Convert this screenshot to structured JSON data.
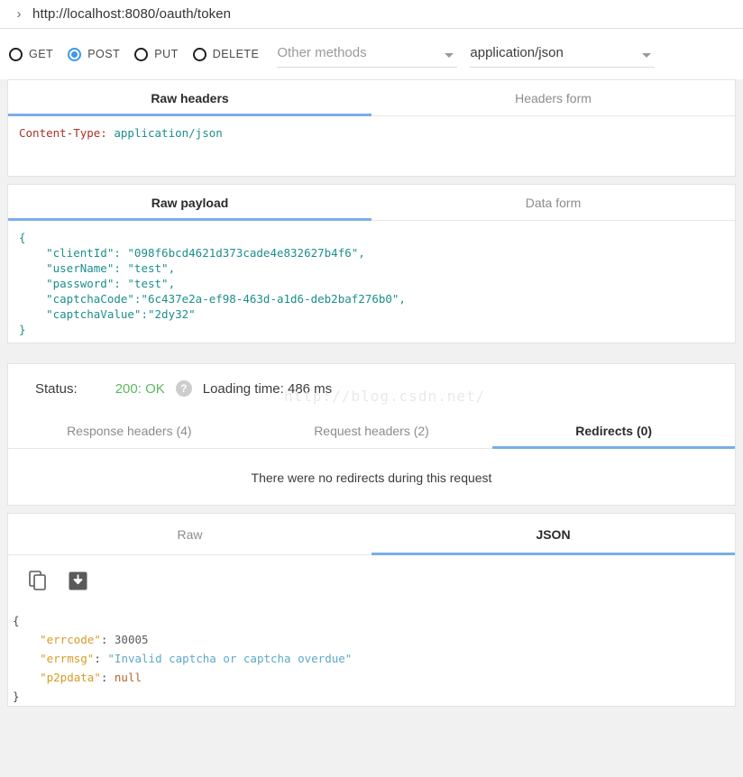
{
  "url_bar": {
    "chevron": "›",
    "url": "http://localhost:8080/oauth/token"
  },
  "method_row": {
    "methods": [
      {
        "label": "GET",
        "selected": false
      },
      {
        "label": "POST",
        "selected": true
      },
      {
        "label": "PUT",
        "selected": false
      },
      {
        "label": "DELETE",
        "selected": false
      }
    ],
    "other_methods_placeholder": "Other methods",
    "content_type_value": "application/json"
  },
  "headers_section": {
    "tabs": [
      {
        "label": "Raw headers",
        "active": true
      },
      {
        "label": "Headers form",
        "active": false
      }
    ],
    "raw": {
      "name": "Content-Type:",
      "value": "application/json"
    }
  },
  "payload_section": {
    "tabs": [
      {
        "label": "Raw payload",
        "active": true
      },
      {
        "label": "Data form",
        "active": false
      }
    ],
    "body": "{\n    \"clientId\": \"098f6bcd4621d373cade4e832627b4f6\",\n    \"userName\": \"test\",\n    \"password\": \"test\",\n    \"captchaCode\":\"6c437e2a-ef98-463d-a1d6-deb2baf276b0\",\n    \"captchaValue\":\"2dy32\"\n}"
  },
  "watermark": "http://blog.csdn.net/",
  "status_section": {
    "status_label": "Status:",
    "status_code": "200: OK",
    "help_icon": "?",
    "loading_time": "Loading time: 486 ms",
    "tabs": [
      {
        "label": "Response headers (4)",
        "active": false
      },
      {
        "label": "Request headers (2)",
        "active": false
      },
      {
        "label": "Redirects (0)",
        "active": true
      }
    ],
    "redirect_message": "There were no redirects during this request"
  },
  "response_section": {
    "tabs": [
      {
        "label": "Raw",
        "active": false
      },
      {
        "label": "JSON",
        "active": true
      }
    ],
    "toolbar": {
      "copy_icon": "copy-icon",
      "save_icon": "save-icon"
    },
    "json": {
      "open_brace": "{",
      "close_brace": "}",
      "lines": [
        {
          "key": "\"errcode\"",
          "sep": ": ",
          "value": "30005",
          "type": "num"
        },
        {
          "key": "\"errmsg\"",
          "sep": ": ",
          "value": "\"Invalid captcha or captcha overdue\"",
          "type": "str"
        },
        {
          "key": "\"p2pdata\"",
          "sep": ": ",
          "value": "null",
          "type": "null"
        }
      ]
    }
  },
  "colors": {
    "accent": "#7aaee8",
    "radio_selected": "#3d9ae8",
    "status_ok": "#5cb85c",
    "header_name": "#a93226",
    "header_value": "#1a8f8f",
    "payload_text": "#1c8f8a",
    "json_key": "#d79b28",
    "json_string": "#5fa8c8",
    "watermark": "#e9e9e9"
  }
}
